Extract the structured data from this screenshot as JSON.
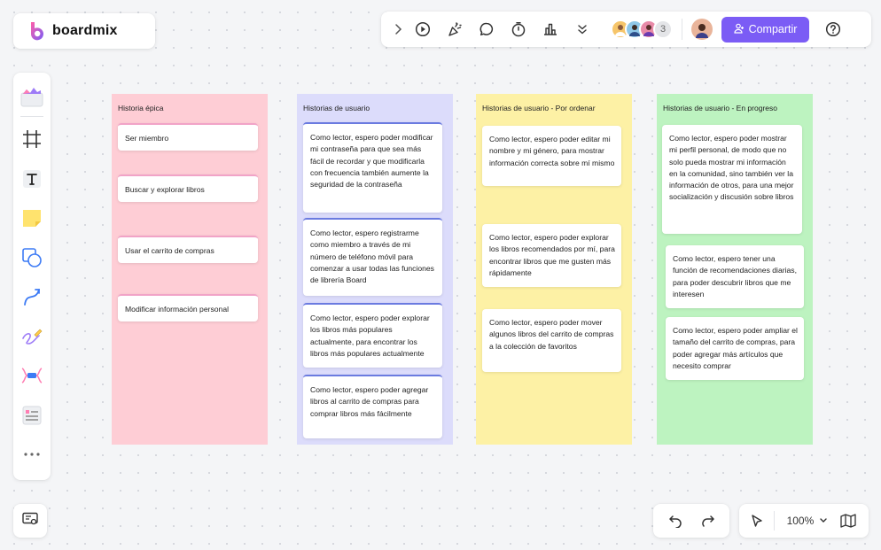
{
  "app": {
    "name": "boardmix"
  },
  "toolbar": {
    "share_label": "Compartir",
    "collaborators_extra": "3"
  },
  "zoom": {
    "level": "100%"
  },
  "colors": {
    "accent": "#7b5cf5",
    "pink": "#fecdd5",
    "lavender": "#dcdcfb",
    "yellow": "#fdf1a5",
    "green": "#bdf3c0"
  },
  "columns": [
    {
      "title": "Historia épica",
      "cards": [
        "Ser miembro",
        "Buscar y explorar libros",
        "Usar el carrito de compras",
        "Modificar información personal"
      ]
    },
    {
      "title": "Historias de usuario",
      "cards": [
        "Como lector, espero poder modificar mi contraseña para que sea más fácil de recordar y que modificarla con frecuencia también aumente la seguridad de la contraseña",
        "Como lector, espero registrarme como miembro a través de mi número de teléfono móvil para comenzar a usar todas las funciones de librería Board",
        "Como lector, espero poder explorar los libros más populares actualmente, para encontrar los libros más populares actualmente",
        "Como lector, espero poder agregar libros al carrito de compras para comprar libros más fácilmente"
      ]
    },
    {
      "title": "Historias de usuario - Por ordenar",
      "cards": [
        "Como lector, espero poder editar mi nombre y mi género, para mostrar información correcta sobre mí mismo",
        "Como lector, espero poder explorar los libros recomendados por mí, para encontrar libros que me gusten más rápidamente",
        "Como lector, espero poder mover algunos libros del carrito de compras a la colección de favoritos"
      ]
    },
    {
      "title": "Historias de usuario - En progreso",
      "cards": [
        "Como lector, espero poder mostrar mi perfil personal, de modo que no solo pueda mostrar mi información en la comunidad, sino también ver la información de otros, para una mejor socialización y discusión sobre libros",
        "Como lector, espero tener una función de recomendaciones diarias, para poder descubrir libros que me interesen",
        "Como lector, espero poder ampliar el tamaño del carrito de compras, para poder agregar más artículos que necesito comprar"
      ]
    }
  ],
  "icons": {
    "top_toolbar": [
      "chevron-right-icon",
      "play-icon",
      "celebrate-icon",
      "comment-icon",
      "timer-icon",
      "vote-icon",
      "more-down-icon"
    ],
    "left_toolbar": [
      "templates-icon",
      "frame-icon",
      "text-icon",
      "sticky-note-icon",
      "shape-icon",
      "connector-icon",
      "pen-icon",
      "mindmap-icon",
      "list-card-icon",
      "more-icon"
    ],
    "bottom": [
      "present-icon",
      "undo-icon",
      "redo-icon",
      "select-cursor-icon",
      "chevron-down-icon",
      "map-icon",
      "help-icon"
    ]
  }
}
